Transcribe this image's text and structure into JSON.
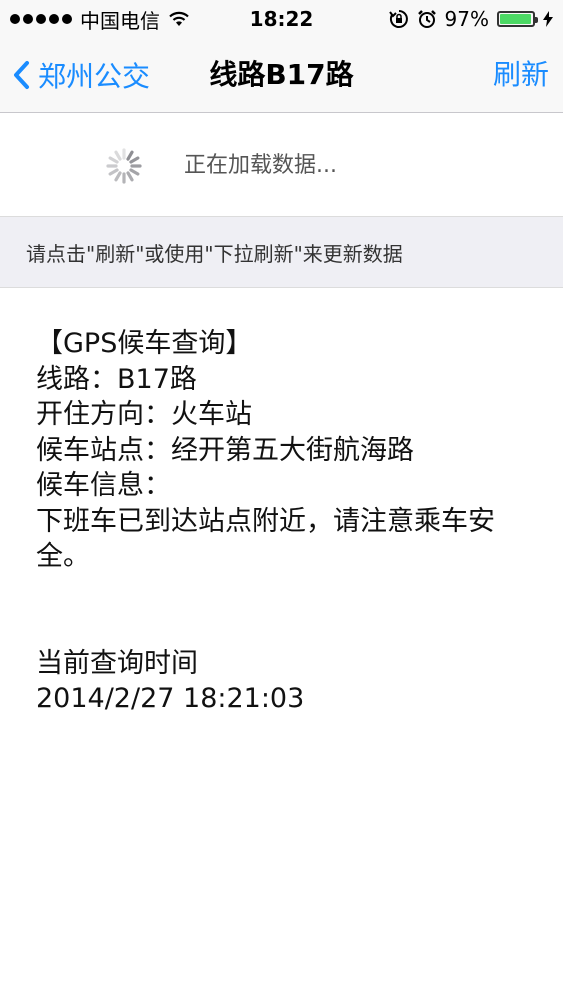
{
  "status_bar": {
    "carrier": "中国电信",
    "time": "18:22",
    "battery_percent": "97%",
    "battery_level": 0.97,
    "accent_color": "#4cd964",
    "icons": [
      "signal-dots-icon",
      "wifi-icon",
      "rotation-lock-icon",
      "alarm-icon",
      "battery-icon",
      "charging-bolt-icon"
    ]
  },
  "nav": {
    "back_label": "郑州公交",
    "title": "线路B17路",
    "refresh_label": "刷新",
    "accent_color": "#1a8cff"
  },
  "loading": {
    "text": "正在加载数据..."
  },
  "hint": {
    "text": "请点击\"刷新\"或使用\"下拉刷新\"来更新数据"
  },
  "info": {
    "heading": "【GPS候车查询】",
    "line": "线路：B17路",
    "direction": "开住方向：火车站",
    "station": "候车站点：经开第五大街航海路",
    "info_label": "候车信息：",
    "info_message": "下班车已到达站点附近，请注意乘车安全。",
    "query_time_label": "当前查询时间",
    "query_time": "2014/2/27 18:21:03"
  }
}
